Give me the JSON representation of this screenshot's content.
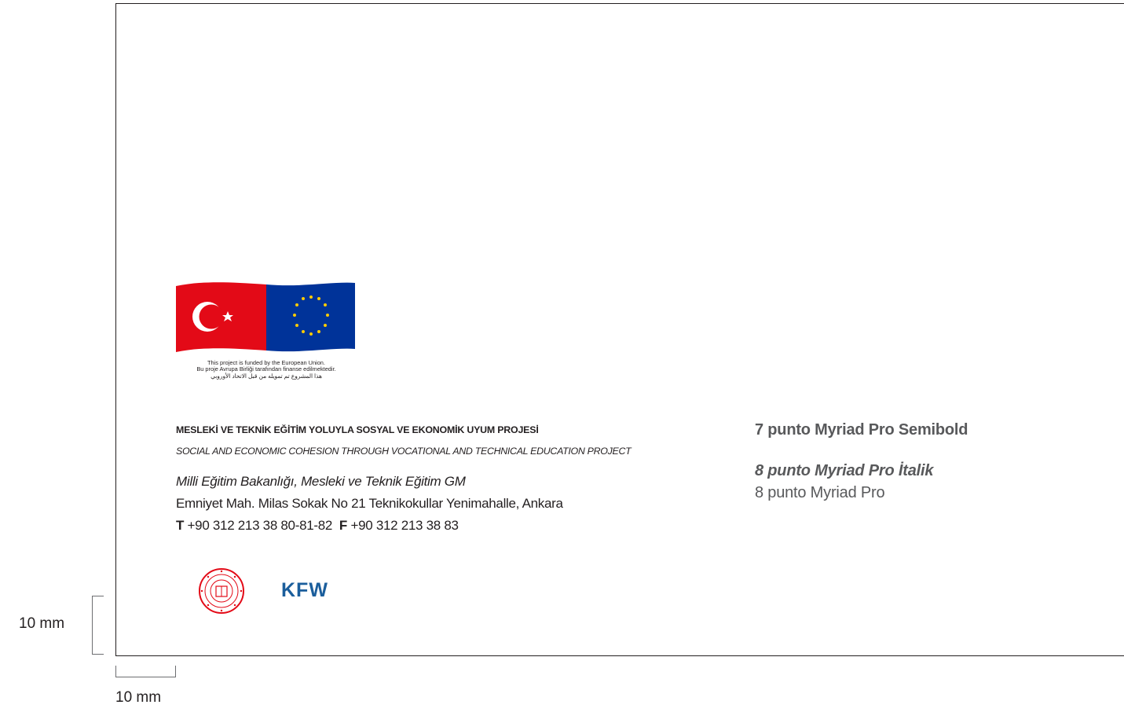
{
  "funding_note": {
    "en": "This project is funded by the European Union.",
    "tr": "Bu proje Avrupa Birliği tarafından finanse edilmektedir.",
    "ar": "هذا المشروع تم تمويله من قبل الاتحاد الأوروبي"
  },
  "project": {
    "title_tr": "MESLEKİ VE TEKNİK EĞİTİM YOLUYLA SOSYAL VE EKONOMİK UYUM PROJESİ",
    "title_en": "SOCIAL AND ECONOMIC COHESION THROUGH VOCATIONAL AND TECHNICAL EDUCATION PROJECT"
  },
  "address": {
    "ministry": "Milli Eğitim Bakanlığı, Mesleki ve Teknik Eğitim GM",
    "street": "Emniyet Mah. Milas Sokak No 21 Teknikokullar Yenimahalle, Ankara",
    "tel_label": "T",
    "tel": "+90 312 213 38 80-81-82",
    "fax_label": "F",
    "fax": "+90 312 213 38 83"
  },
  "legend": {
    "semibold": "7 punto Myriad Pro Semibold",
    "italic": "8 punto Myriad Pro İtalik",
    "regular": "8 punto Myriad Pro"
  },
  "logos": {
    "kfw": "KFW"
  },
  "dimensions": {
    "vertical": "10 mm",
    "horizontal": "10 mm"
  },
  "colors": {
    "turkey_red": "#e30a17",
    "eu_blue": "#003399",
    "eu_gold": "#ffcc00",
    "kfw_blue": "#1b5e9c",
    "legend_gray": "#58595b"
  }
}
